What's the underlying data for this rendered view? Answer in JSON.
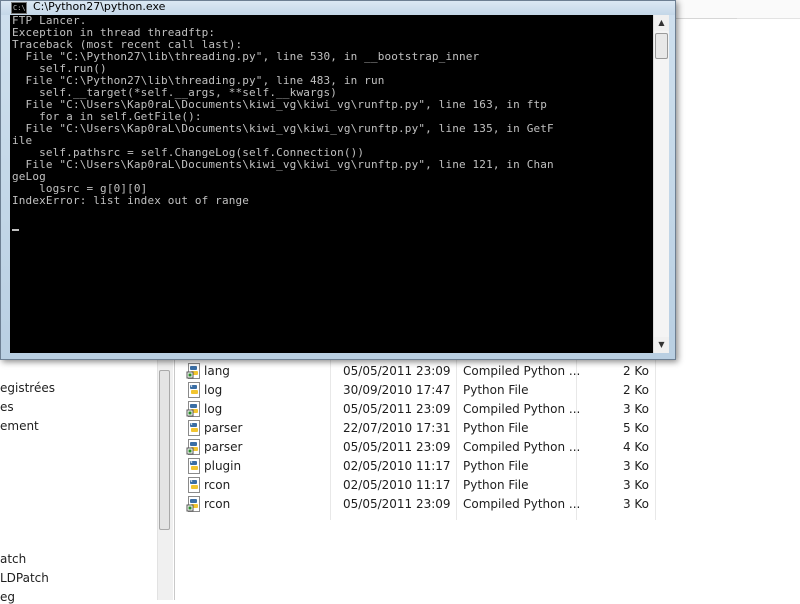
{
  "console": {
    "title": "C:\\Python27\\python.exe",
    "icon_text": "C:\\",
    "output": "FTP Lancer.\nException in thread threadftp:\nTraceback (most recent call last):\n  File \"C:\\Python27\\lib\\threading.py\", line 530, in __bootstrap_inner\n    self.run()\n  File \"C:\\Python27\\lib\\threading.py\", line 483, in run\n    self.__target(*self.__args, **self.__kwargs)\n  File \"C:\\Users\\Kap0raL\\Documents\\kiwi_vg\\kiwi_vg\\runftp.py\", line 163, in ftp\n    for a in self.GetFile():\n  File \"C:\\Users\\Kap0raL\\Documents\\kiwi_vg\\kiwi_vg\\runftp.py\", line 135, in GetF\nile\n    self.pathsrc = self.ChangeLog(self.Connection())\n  File \"C:\\Users\\Kap0raL\\Documents\\kiwi_vg\\kiwi_vg\\runftp.py\", line 121, in Chan\ngeLog\n    logsrc = g[0][0]\nIndexError: list index out of range",
    "scroll_up_glyph": "▲",
    "scroll_down_glyph": "▼"
  },
  "navigation": {
    "items": [
      "egistrées",
      "es",
      "ement",
      "atch",
      "LDPatch",
      "eg"
    ]
  },
  "files": [
    {
      "name": "lang",
      "date": "05/05/2011 23:09",
      "type": "Compiled Python ...",
      "size": "2 Ko",
      "icon": "compiled-python-icon"
    },
    {
      "name": "log",
      "date": "30/09/2010 17:47",
      "type": "Python File",
      "size": "2 Ko",
      "icon": "python-file-icon"
    },
    {
      "name": "log",
      "date": "05/05/2011 23:09",
      "type": "Compiled Python ...",
      "size": "3 Ko",
      "icon": "compiled-python-icon"
    },
    {
      "name": "parser",
      "date": "22/07/2010 17:31",
      "type": "Python File",
      "size": "5 Ko",
      "icon": "python-file-icon"
    },
    {
      "name": "parser",
      "date": "05/05/2011 23:09",
      "type": "Compiled Python ...",
      "size": "4 Ko",
      "icon": "compiled-python-icon"
    },
    {
      "name": "plugin",
      "date": "02/05/2010 11:17",
      "type": "Python File",
      "size": "3 Ko",
      "icon": "python-file-icon"
    },
    {
      "name": "rcon",
      "date": "02/05/2010 11:17",
      "type": "Python File",
      "size": "3 Ko",
      "icon": "python-file-icon"
    },
    {
      "name": "rcon",
      "date": "05/05/2011 23:09",
      "type": "Compiled Python ...",
      "size": "3 Ko",
      "icon": "compiled-python-icon"
    }
  ],
  "colors": {
    "terminal_bg": "#000000",
    "terminal_fg": "#c0c0c0",
    "window_frame": "#c4d7e8"
  }
}
